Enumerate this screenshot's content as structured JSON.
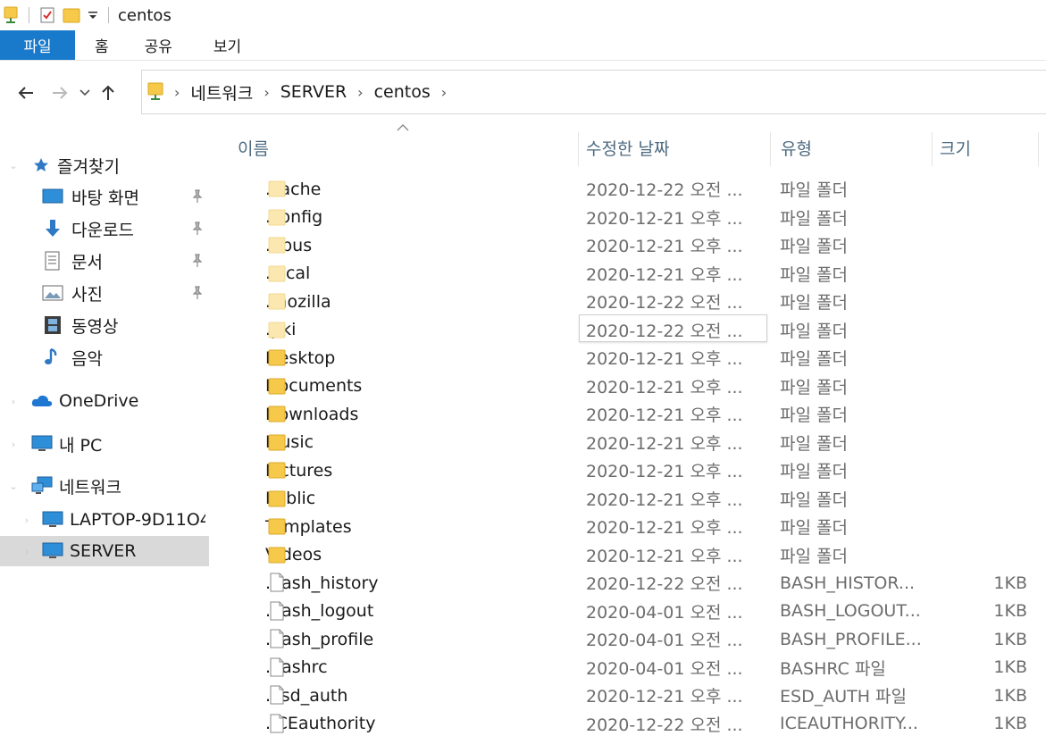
{
  "window": {
    "title": "centos"
  },
  "ribbon": {
    "tabs": [
      "파일",
      "홈",
      "공유",
      "보기"
    ]
  },
  "address": {
    "crumbs": [
      "네트워크",
      "SERVER",
      "centos"
    ]
  },
  "nav": {
    "quick_access": "즐겨찾기",
    "quick_items": [
      "바탕 화면",
      "다운로드",
      "문서",
      "사진",
      "동영상",
      "음악"
    ],
    "onedrive": "OneDrive",
    "mypc": "내 PC",
    "network": "네트워크",
    "network_items": [
      "LAPTOP-9D11O4",
      "SERVER"
    ]
  },
  "columns": {
    "name": "이름",
    "date": "수정한 날짜",
    "type": "유형",
    "size": "크기"
  },
  "files": [
    {
      "name": ".cache",
      "date": "2020-12-22 오전 ...",
      "type": "파일 폴더",
      "size": "",
      "kind": "hidden-folder"
    },
    {
      "name": ".config",
      "date": "2020-12-21 오후 ...",
      "type": "파일 폴더",
      "size": "",
      "kind": "hidden-folder"
    },
    {
      "name": ".dbus",
      "date": "2020-12-21 오후 ...",
      "type": "파일 폴더",
      "size": "",
      "kind": "hidden-folder"
    },
    {
      "name": ".local",
      "date": "2020-12-21 오후 ...",
      "type": "파일 폴더",
      "size": "",
      "kind": "hidden-folder"
    },
    {
      "name": ".mozilla",
      "date": "2020-12-22 오전 ...",
      "type": "파일 폴더",
      "size": "",
      "kind": "hidden-folder"
    },
    {
      "name": ".pki",
      "date": "2020-12-22 오전 ...",
      "type": "파일 폴더",
      "size": "",
      "kind": "hidden-folder"
    },
    {
      "name": "Desktop",
      "date": "2020-12-21 오후 ...",
      "type": "파일 폴더",
      "size": "",
      "kind": "folder"
    },
    {
      "name": "Documents",
      "date": "2020-12-21 오후 ...",
      "type": "파일 폴더",
      "size": "",
      "kind": "folder"
    },
    {
      "name": "Downloads",
      "date": "2020-12-21 오후 ...",
      "type": "파일 폴더",
      "size": "",
      "kind": "folder"
    },
    {
      "name": "Music",
      "date": "2020-12-21 오후 ...",
      "type": "파일 폴더",
      "size": "",
      "kind": "folder"
    },
    {
      "name": "Pictures",
      "date": "2020-12-21 오후 ...",
      "type": "파일 폴더",
      "size": "",
      "kind": "folder"
    },
    {
      "name": "Public",
      "date": "2020-12-21 오후 ...",
      "type": "파일 폴더",
      "size": "",
      "kind": "folder"
    },
    {
      "name": "Templates",
      "date": "2020-12-21 오후 ...",
      "type": "파일 폴더",
      "size": "",
      "kind": "folder"
    },
    {
      "name": "Videos",
      "date": "2020-12-21 오후 ...",
      "type": "파일 폴더",
      "size": "",
      "kind": "folder"
    },
    {
      "name": ".bash_history",
      "date": "2020-12-22 오전 ...",
      "type": "BASH_HISTOR...",
      "size": "1KB",
      "kind": "file"
    },
    {
      "name": ".bash_logout",
      "date": "2020-04-01 오전 ...",
      "type": "BASH_LOGOUT...",
      "size": "1KB",
      "kind": "file"
    },
    {
      "name": ".bash_profile",
      "date": "2020-04-01 오전 ...",
      "type": "BASH_PROFILE...",
      "size": "1KB",
      "kind": "file"
    },
    {
      "name": ".bashrc",
      "date": "2020-04-01 오전 ...",
      "type": "BASHRC 파일",
      "size": "1KB",
      "kind": "file"
    },
    {
      "name": ".esd_auth",
      "date": "2020-12-21 오후 ...",
      "type": "ESD_AUTH 파일",
      "size": "1KB",
      "kind": "file"
    },
    {
      "name": ".ICEauthority",
      "date": "2020-12-22 오전 ...",
      "type": "ICEAUTHORITY...",
      "size": "1KB",
      "kind": "file"
    }
  ],
  "colors": {
    "accent": "#1979ca",
    "folder": "#f6c94a",
    "hidden_folder": "#fbe7b0",
    "selection": "#d9d9d9"
  }
}
